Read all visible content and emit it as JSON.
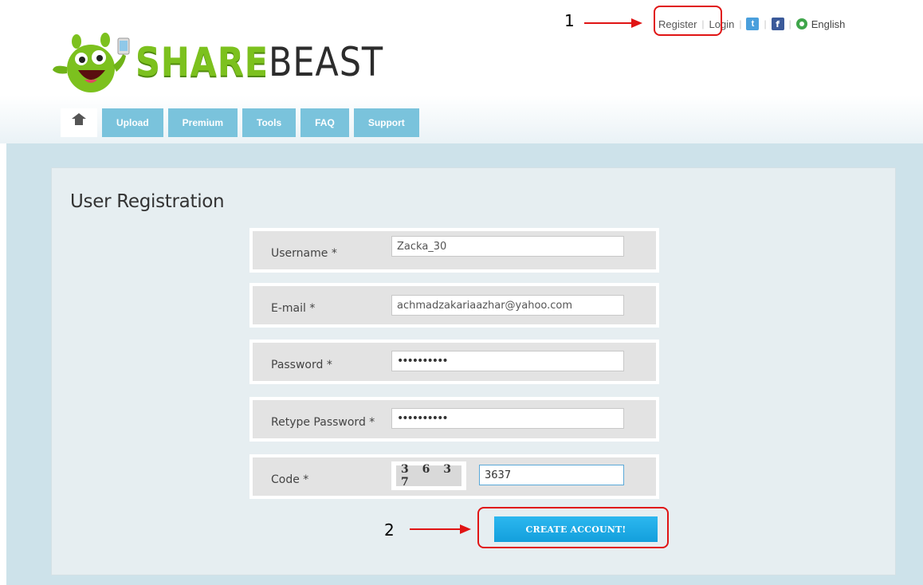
{
  "header": {
    "logo": {
      "part1": "SHARE",
      "part2": "BEAST"
    },
    "top_links": {
      "register": "Register",
      "login": "Login",
      "language": "English"
    }
  },
  "nav": {
    "tabs": [
      {
        "label": "Upload"
      },
      {
        "label": "Premium"
      },
      {
        "label": "Tools"
      },
      {
        "label": "FAQ"
      },
      {
        "label": "Support"
      }
    ]
  },
  "form": {
    "title": "User Registration",
    "fields": {
      "username": {
        "label": "Username *",
        "value": "Zacka_30"
      },
      "email": {
        "label": "E-mail *",
        "value": "achmadzakariaazhar@yahoo.com"
      },
      "password": {
        "label": "Password *",
        "value": "••••••••••"
      },
      "retype_password": {
        "label": "Retype Password *",
        "value": "••••••••••"
      },
      "code": {
        "label": "Code *",
        "captcha": "3 6 3 7",
        "value": "3637"
      }
    },
    "submit_label": "CREATE ACCOUNT!"
  },
  "annotations": {
    "step1": "1",
    "step2": "2"
  },
  "colors": {
    "tab": "#7ac3dc",
    "button": "#1aa9e6",
    "annotation": "#e01414",
    "logo_green": "#7cc11e"
  }
}
